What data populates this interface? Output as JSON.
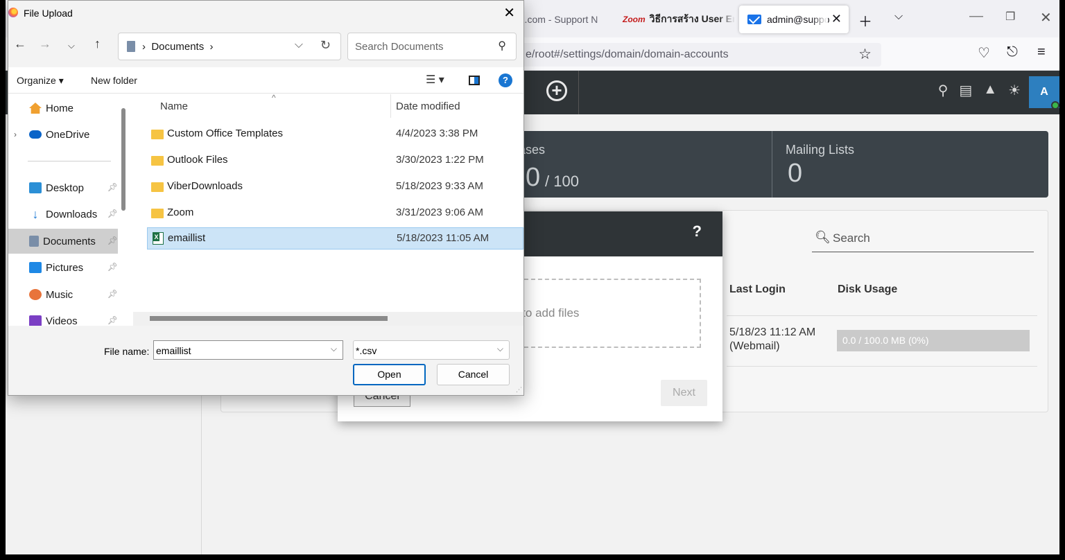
{
  "browser": {
    "tabs": [
      {
        "label": "Z.com - Support N"
      },
      {
        "logo": "Zoom",
        "label": "วิธีการสร้าง User En"
      },
      {
        "label": "admin@suppo"
      }
    ],
    "url": "e/root#/settings/domain/domain-accounts"
  },
  "app": {
    "avatar": "A",
    "stats": {
      "aliases_label": "ases",
      "aliases_value": "0",
      "aliases_max": "/ 100",
      "mailing_label": "Mailing Lists",
      "mailing_value": "0"
    },
    "search_placeholder": "Search",
    "columns": {
      "last_login": "Last Login",
      "disk_usage": "Disk Usage"
    },
    "row": {
      "last_login": "5/18/23 11:12 AM (Webmail)",
      "disk_usage": "0.0 / 100.0 MB (0%)"
    }
  },
  "modal": {
    "help": "?",
    "dropzone_text": "p to add files",
    "cancel_label": "Cancel",
    "next_label": "Next"
  },
  "dialog": {
    "title": "File Upload",
    "path_crumb": "Documents",
    "search_placeholder": "Search Documents",
    "organize_label": "Organize ▾",
    "new_folder_label": "New folder",
    "nav_items": [
      {
        "label": "Home",
        "icon": "home-icon"
      },
      {
        "label": "OneDrive",
        "icon": "cloud-icon"
      },
      {
        "label": "Desktop",
        "icon": "desktop-icon"
      },
      {
        "label": "Downloads",
        "icon": "download-icon"
      },
      {
        "label": "Documents",
        "icon": "documents-icon"
      },
      {
        "label": "Pictures",
        "icon": "pictures-icon"
      },
      {
        "label": "Music",
        "icon": "music-icon"
      },
      {
        "label": "Videos",
        "icon": "videos-icon"
      }
    ],
    "columns": {
      "name": "Name",
      "date": "Date modified"
    },
    "files": [
      {
        "name": "Custom Office Templates",
        "date": "4/4/2023 3:38 PM",
        "type": "folder"
      },
      {
        "name": "Outlook Files",
        "date": "3/30/2023 1:22 PM",
        "type": "folder"
      },
      {
        "name": "ViberDownloads",
        "date": "5/18/2023 9:33 AM",
        "type": "folder"
      },
      {
        "name": "Zoom",
        "date": "3/31/2023 9:06 AM",
        "type": "folder"
      },
      {
        "name": "emaillist",
        "date": "5/18/2023 11:05 AM",
        "type": "excel"
      }
    ],
    "file_name_label": "File name:",
    "file_name_value": "emaillist",
    "file_type": "*.csv",
    "open_label": "Open",
    "cancel_label": "Cancel"
  },
  "colors": {
    "app_dark": "#2f3437",
    "stats_bg": "#3b4349",
    "selection": "#cce4f7",
    "accent": "#0067c0"
  }
}
